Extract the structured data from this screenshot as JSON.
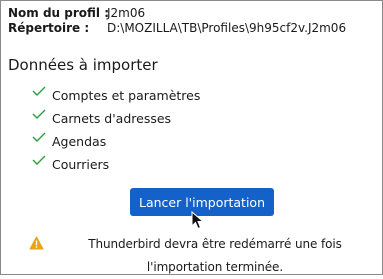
{
  "profile": {
    "name_label": "Nom du profil :",
    "name_value": "J2m06",
    "directory_label": "Répertoire :",
    "directory_value": "D:\\MOZILLA\\TB\\Profiles\\9h95cf2v.J2m06"
  },
  "import_section": {
    "title": "Données à importer",
    "items": [
      {
        "label": "Comptes et paramètres",
        "icon": "check-icon"
      },
      {
        "label": "Carnets d'adresses",
        "icon": "check-icon"
      },
      {
        "label": "Agendas",
        "icon": "check-icon"
      },
      {
        "label": "Courriers",
        "icon": "check-icon"
      }
    ]
  },
  "actions": {
    "import_button_label": "Lancer l'importation"
  },
  "warning": {
    "icon": "warning-icon",
    "text": "Thunderbird devra être redémarré une fois l'importation terminée."
  },
  "colors": {
    "button": "#1461c9",
    "check": "#2e9e3e",
    "warning": "#e8a317"
  }
}
